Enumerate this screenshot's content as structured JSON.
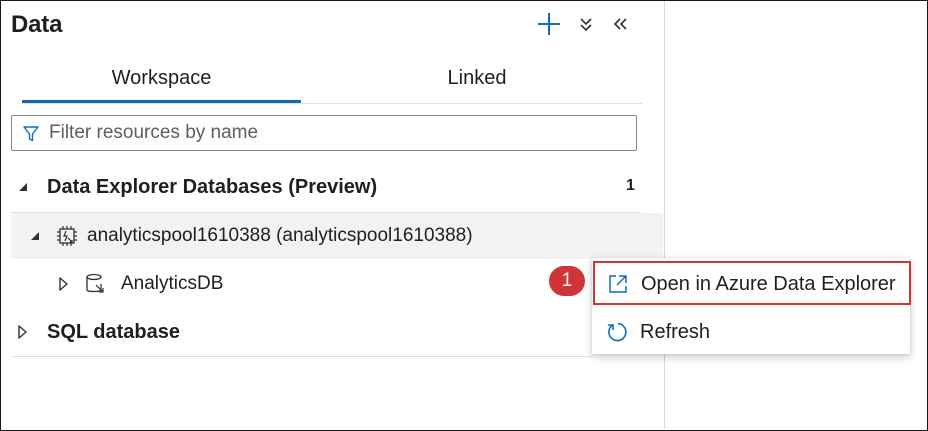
{
  "panel": {
    "title": "Data",
    "add_icon": "plus-icon",
    "collapse_all_icon": "double-chevron-down-icon",
    "collapse_panel_icon": "double-chevron-left-icon"
  },
  "tabs": [
    {
      "label": "Workspace",
      "active": true
    },
    {
      "label": "Linked",
      "active": false
    }
  ],
  "filter": {
    "placeholder": "Filter resources by name",
    "value": "",
    "icon": "filter-icon"
  },
  "tree": {
    "data_explorer": {
      "label": "Data Explorer Databases (Preview)",
      "count": "1",
      "expanded": true
    },
    "pool": {
      "label": "analyticspool1610388 (analyticspool1610388)",
      "expanded": true,
      "icon": "data-explorer-pool-icon"
    },
    "database": {
      "label": "AnalyticsDB",
      "expanded": false,
      "icon": "database-icon"
    },
    "sql": {
      "label": "SQL database",
      "expanded": false
    }
  },
  "context_menu": {
    "items": [
      {
        "label": "Open in Azure Data Explorer",
        "icon": "open-external-icon"
      },
      {
        "label": "Refresh",
        "icon": "refresh-icon"
      }
    ]
  },
  "callout": {
    "number": "1"
  },
  "colors": {
    "accent": "#0f6cbd",
    "highlight": "#d13438",
    "selected_row": "#f3f2f1"
  }
}
